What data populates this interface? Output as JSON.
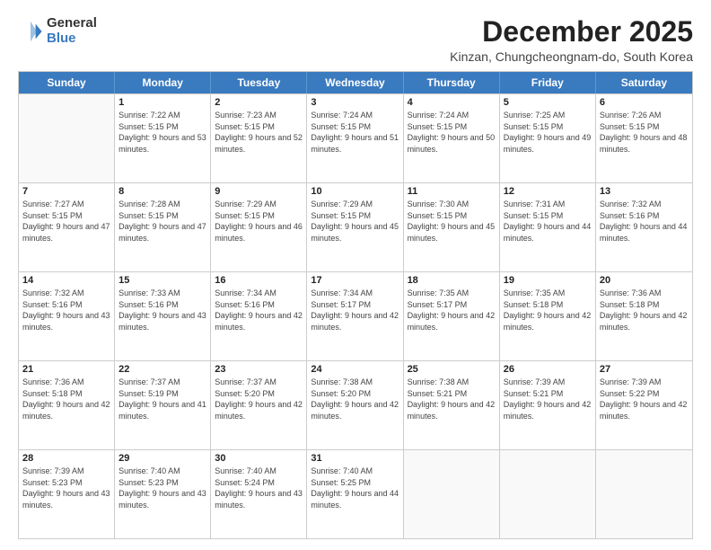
{
  "logo": {
    "general": "General",
    "blue": "Blue"
  },
  "title": "December 2025",
  "subtitle": "Kinzan, Chungcheongnam-do, South Korea",
  "weekdays": [
    "Sunday",
    "Monday",
    "Tuesday",
    "Wednesday",
    "Thursday",
    "Friday",
    "Saturday"
  ],
  "weeks": [
    [
      {
        "day": "",
        "empty": true
      },
      {
        "day": "1",
        "sunrise": "7:22 AM",
        "sunset": "5:15 PM",
        "daylight": "9 hours and 53 minutes."
      },
      {
        "day": "2",
        "sunrise": "7:23 AM",
        "sunset": "5:15 PM",
        "daylight": "9 hours and 52 minutes."
      },
      {
        "day": "3",
        "sunrise": "7:24 AM",
        "sunset": "5:15 PM",
        "daylight": "9 hours and 51 minutes."
      },
      {
        "day": "4",
        "sunrise": "7:24 AM",
        "sunset": "5:15 PM",
        "daylight": "9 hours and 50 minutes."
      },
      {
        "day": "5",
        "sunrise": "7:25 AM",
        "sunset": "5:15 PM",
        "daylight": "9 hours and 49 minutes."
      },
      {
        "day": "6",
        "sunrise": "7:26 AM",
        "sunset": "5:15 PM",
        "daylight": "9 hours and 48 minutes."
      }
    ],
    [
      {
        "day": "7",
        "sunrise": "7:27 AM",
        "sunset": "5:15 PM",
        "daylight": "9 hours and 47 minutes."
      },
      {
        "day": "8",
        "sunrise": "7:28 AM",
        "sunset": "5:15 PM",
        "daylight": "9 hours and 47 minutes."
      },
      {
        "day": "9",
        "sunrise": "7:29 AM",
        "sunset": "5:15 PM",
        "daylight": "9 hours and 46 minutes."
      },
      {
        "day": "10",
        "sunrise": "7:29 AM",
        "sunset": "5:15 PM",
        "daylight": "9 hours and 45 minutes."
      },
      {
        "day": "11",
        "sunrise": "7:30 AM",
        "sunset": "5:15 PM",
        "daylight": "9 hours and 45 minutes."
      },
      {
        "day": "12",
        "sunrise": "7:31 AM",
        "sunset": "5:15 PM",
        "daylight": "9 hours and 44 minutes."
      },
      {
        "day": "13",
        "sunrise": "7:32 AM",
        "sunset": "5:16 PM",
        "daylight": "9 hours and 44 minutes."
      }
    ],
    [
      {
        "day": "14",
        "sunrise": "7:32 AM",
        "sunset": "5:16 PM",
        "daylight": "9 hours and 43 minutes."
      },
      {
        "day": "15",
        "sunrise": "7:33 AM",
        "sunset": "5:16 PM",
        "daylight": "9 hours and 43 minutes."
      },
      {
        "day": "16",
        "sunrise": "7:34 AM",
        "sunset": "5:16 PM",
        "daylight": "9 hours and 42 minutes."
      },
      {
        "day": "17",
        "sunrise": "7:34 AM",
        "sunset": "5:17 PM",
        "daylight": "9 hours and 42 minutes."
      },
      {
        "day": "18",
        "sunrise": "7:35 AM",
        "sunset": "5:17 PM",
        "daylight": "9 hours and 42 minutes."
      },
      {
        "day": "19",
        "sunrise": "7:35 AM",
        "sunset": "5:18 PM",
        "daylight": "9 hours and 42 minutes."
      },
      {
        "day": "20",
        "sunrise": "7:36 AM",
        "sunset": "5:18 PM",
        "daylight": "9 hours and 42 minutes."
      }
    ],
    [
      {
        "day": "21",
        "sunrise": "7:36 AM",
        "sunset": "5:18 PM",
        "daylight": "9 hours and 42 minutes."
      },
      {
        "day": "22",
        "sunrise": "7:37 AM",
        "sunset": "5:19 PM",
        "daylight": "9 hours and 41 minutes."
      },
      {
        "day": "23",
        "sunrise": "7:37 AM",
        "sunset": "5:20 PM",
        "daylight": "9 hours and 42 minutes."
      },
      {
        "day": "24",
        "sunrise": "7:38 AM",
        "sunset": "5:20 PM",
        "daylight": "9 hours and 42 minutes."
      },
      {
        "day": "25",
        "sunrise": "7:38 AM",
        "sunset": "5:21 PM",
        "daylight": "9 hours and 42 minutes."
      },
      {
        "day": "26",
        "sunrise": "7:39 AM",
        "sunset": "5:21 PM",
        "daylight": "9 hours and 42 minutes."
      },
      {
        "day": "27",
        "sunrise": "7:39 AM",
        "sunset": "5:22 PM",
        "daylight": "9 hours and 42 minutes."
      }
    ],
    [
      {
        "day": "28",
        "sunrise": "7:39 AM",
        "sunset": "5:23 PM",
        "daylight": "9 hours and 43 minutes."
      },
      {
        "day": "29",
        "sunrise": "7:40 AM",
        "sunset": "5:23 PM",
        "daylight": "9 hours and 43 minutes."
      },
      {
        "day": "30",
        "sunrise": "7:40 AM",
        "sunset": "5:24 PM",
        "daylight": "9 hours and 43 minutes."
      },
      {
        "day": "31",
        "sunrise": "7:40 AM",
        "sunset": "5:25 PM",
        "daylight": "9 hours and 44 minutes."
      },
      {
        "day": "",
        "empty": true
      },
      {
        "day": "",
        "empty": true
      },
      {
        "day": "",
        "empty": true
      }
    ]
  ]
}
